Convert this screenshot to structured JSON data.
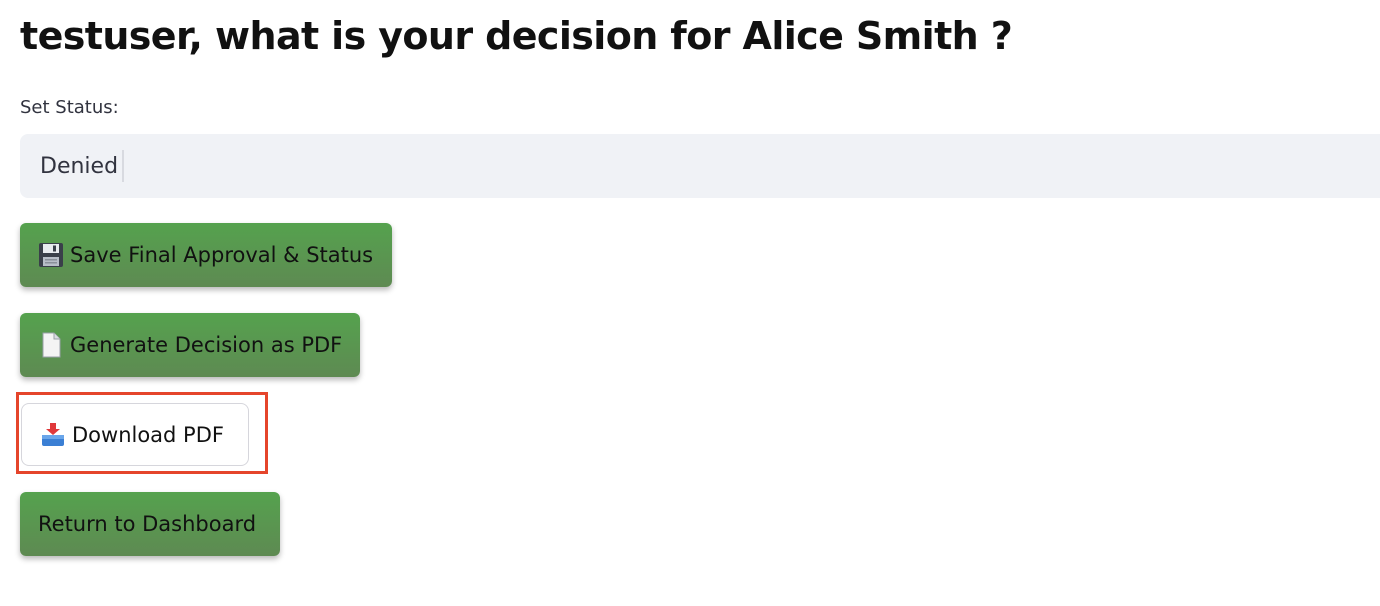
{
  "header": {
    "title": "testuser, what is your decision for Alice Smith ?"
  },
  "status": {
    "label": "Set Status:",
    "selected_value": "Denied"
  },
  "buttons": {
    "save": {
      "label": "Save Final Approval & Status",
      "icon": "floppy-disk-icon"
    },
    "generate": {
      "label": "Generate Decision as PDF",
      "icon": "page-document-icon"
    },
    "download": {
      "label": "Download PDF",
      "icon": "inbox-tray-icon"
    },
    "return": {
      "label": "Return to Dashboard"
    }
  },
  "colors": {
    "button_green": "#55a24e",
    "select_background": "#f0f2f6",
    "highlight_red": "#e5452b"
  }
}
